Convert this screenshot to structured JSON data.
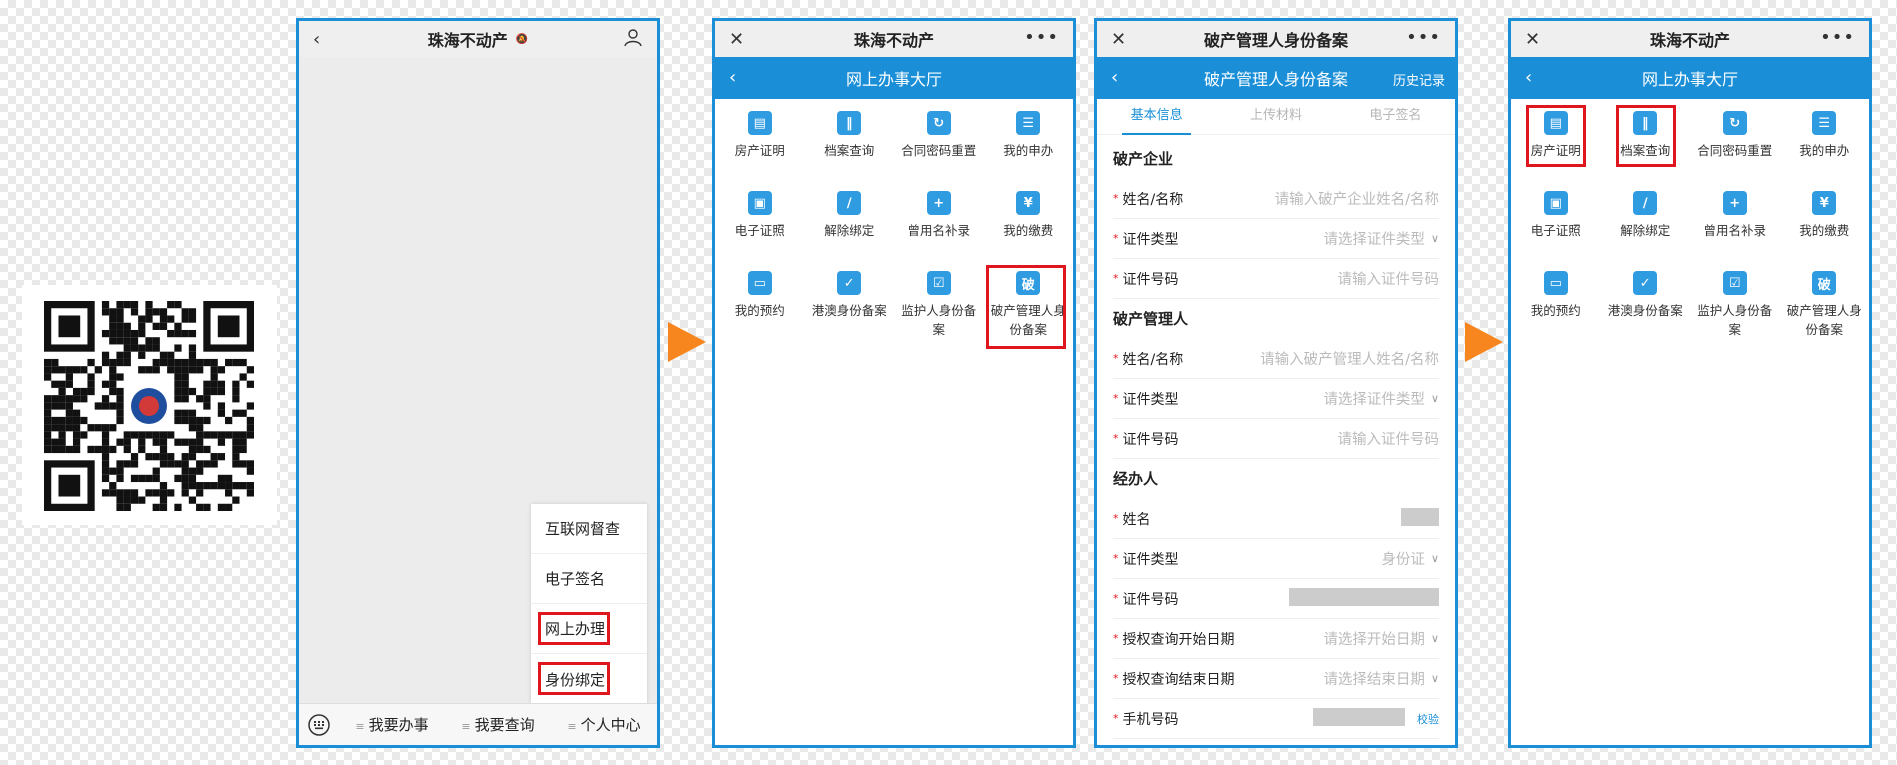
{
  "chat": {
    "title": "珠海不动产",
    "menu": [
      "互联网督查",
      "电子签名",
      "网上办理",
      "身份绑定"
    ],
    "bottom": [
      "我要办事",
      "我要查询",
      "个人中心"
    ]
  },
  "hall": {
    "window_title": "珠海不动产",
    "header": "网上办事大厅",
    "items": [
      {
        "label": "房产证明",
        "icon": "certificate-icon"
      },
      {
        "label": "档案查询",
        "icon": "books-icon"
      },
      {
        "label": "合同密码重置",
        "icon": "lock-reset-icon"
      },
      {
        "label": "我的申办",
        "icon": "list-icon"
      },
      {
        "label": "电子证照",
        "icon": "id-card-icon"
      },
      {
        "label": "解除绑定",
        "icon": "unlink-icon"
      },
      {
        "label": "曾用名补录",
        "icon": "user-add-icon"
      },
      {
        "label": "我的缴费",
        "icon": "yen-icon"
      },
      {
        "label": "我的预约",
        "icon": "monitor-icon"
      },
      {
        "label": "港澳身份备案",
        "icon": "user-check-icon"
      },
      {
        "label": "监护人身份备案",
        "icon": "checklist-icon"
      },
      {
        "label": "破产管理人身份备案",
        "icon": "po-icon",
        "glyph": "破"
      }
    ]
  },
  "form": {
    "window_title": "破产管理人身份备案",
    "header": "破产管理人身份备案",
    "history": "历史记录",
    "tabs": [
      "基本信息",
      "上传材料",
      "电子签名"
    ],
    "sections": [
      {
        "title": "破产企业",
        "rows": [
          {
            "label": "姓名/名称",
            "value": "请输入破产企业姓名/名称"
          },
          {
            "label": "证件类型",
            "value": "请选择证件类型"
          },
          {
            "label": "证件号码",
            "value": "请输入证件号码"
          }
        ]
      },
      {
        "title": "破产管理人",
        "rows": [
          {
            "label": "姓名/名称",
            "value": "请输入破产管理人姓名/名称"
          },
          {
            "label": "证件类型",
            "value": "请选择证件类型"
          },
          {
            "label": "证件号码",
            "value": "请输入证件号码"
          }
        ]
      },
      {
        "title": "经办人",
        "rows": [
          {
            "label": "姓名",
            "value": ""
          },
          {
            "label": "证件类型",
            "value": "身份证"
          },
          {
            "label": "证件号码",
            "value": ""
          },
          {
            "label": "授权查询开始日期",
            "value": "请选择开始日期"
          },
          {
            "label": "授权查询结束日期",
            "value": "请选择结束日期"
          },
          {
            "label": "手机号码",
            "value": "",
            "action": "校验"
          }
        ]
      }
    ]
  }
}
